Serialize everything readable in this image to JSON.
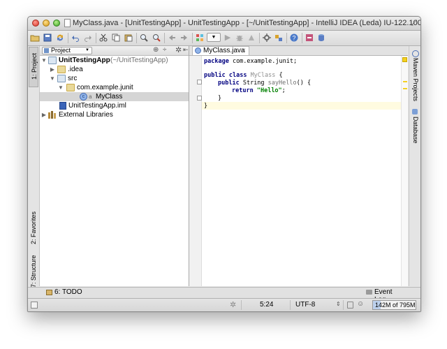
{
  "window": {
    "title": "MyClass.java - [UnitTestingApp] - UnitTestingApp - [~/UnitTestingApp] - IntelliJ IDEA (Leda) IU-122.100"
  },
  "left_stripe": {
    "tabs": [
      "1: Project",
      "2: Favorites",
      "7: Structure"
    ]
  },
  "project_panel": {
    "view_selector": "Project",
    "tree": [
      {
        "label": "UnitTestingApp",
        "suffix": "(~/UnitTestingApp)",
        "icon": "module-icon",
        "expanded": true
      },
      {
        "label": ".idea",
        "icon": "folder-icon",
        "expanded": false
      },
      {
        "label": "src",
        "icon": "source-folder-icon",
        "expanded": true
      },
      {
        "label": "com.example.junit",
        "icon": "package-icon",
        "expanded": true
      },
      {
        "label": "MyClass",
        "icon": "class-icon",
        "selected": true
      },
      {
        "label": "UnitTestingApp.iml",
        "icon": "iml-file-icon"
      },
      {
        "label": "External Libraries",
        "icon": "library-icon",
        "expanded": false
      }
    ]
  },
  "editor": {
    "tab_label": "MyClass.java",
    "tab_close": "×",
    "code": {
      "l1_kw": "package",
      "l1_rest": " com.example.junit;",
      "l3_kw1": "public",
      "l3_kw2": "class",
      "l3_name": "MyClass",
      "l3_brace": " {",
      "l4_kw": "public",
      "l4_type": " String ",
      "l4_method": "sayHello",
      "l4_rest": "() {",
      "l5_kw": "return",
      "l5_str": "\"Hello\"",
      "l5_semi": ";",
      "l6": "}",
      "l7": "}"
    }
  },
  "right_stripe": {
    "tabs": [
      "Maven Projects",
      "Database"
    ]
  },
  "tool_windows": {
    "todo": "6: TODO",
    "event_log": "Event Log"
  },
  "status": {
    "caret": "5:24",
    "encoding": "UTF-8",
    "memory": "142M of 795M"
  },
  "colors": {
    "keyword": "#000080",
    "string": "#008000",
    "selection": "#d5d5d5",
    "current_line": "#fffbe0",
    "warning_marker": "#f4d020"
  }
}
